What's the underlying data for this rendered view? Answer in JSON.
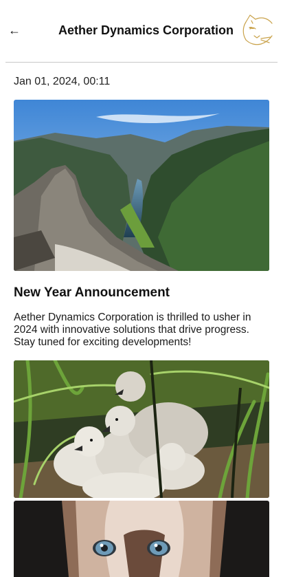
{
  "header": {
    "back_icon": "←",
    "title": "Aether Dynamics Corporation",
    "logo_icon": "cat-head-logo-icon"
  },
  "post": {
    "date": "Jan 01, 2024, 00:11",
    "title": "New Year Announcement",
    "body": "Aether Dynamics Corporation is thrilled to usher in 2024 with innovative solutions that drive progress. Stay tuned for exciting developments!"
  },
  "colors": {
    "divider": "#c8c8c8",
    "logo_gold": "#c9a24a",
    "text": "#111111"
  }
}
